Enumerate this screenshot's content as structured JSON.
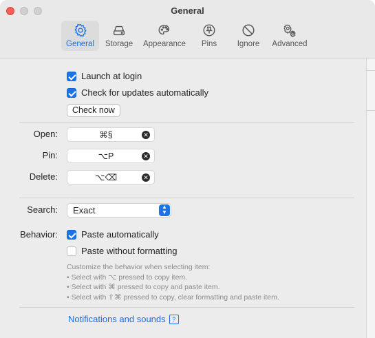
{
  "window": {
    "title": "General"
  },
  "toolbar": {
    "items": [
      {
        "label": "General",
        "icon": "gear-icon",
        "active": true
      },
      {
        "label": "Storage",
        "icon": "disk-icon"
      },
      {
        "label": "Appearance",
        "icon": "palette-icon"
      },
      {
        "label": "Pins",
        "icon": "pin-icon"
      },
      {
        "label": "Ignore",
        "icon": "prohibit-icon"
      },
      {
        "label": "Advanced",
        "icon": "gears-icon"
      }
    ]
  },
  "startup": {
    "launch_at_login": {
      "label": "Launch at login",
      "checked": true
    },
    "check_updates": {
      "label": "Check for updates automatically",
      "checked": true
    },
    "check_now_label": "Check now"
  },
  "shortcuts": {
    "open": {
      "label": "Open:",
      "value": "⌘§"
    },
    "pin": {
      "label": "Pin:",
      "value": "⌥P"
    },
    "delete": {
      "label": "Delete:",
      "value": "⌥⌫"
    }
  },
  "search": {
    "label": "Search:",
    "value": "Exact"
  },
  "behavior": {
    "label": "Behavior:",
    "paste_automatically": {
      "label": "Paste automatically",
      "checked": true
    },
    "paste_without_formatting": {
      "label": "Paste without formatting",
      "checked": false
    },
    "hint": {
      "title": "Customize the behavior when selecting item:",
      "line1": "• Select with ⌥ pressed to copy item.",
      "line2": "• Select with ⌘ pressed to copy and paste item.",
      "line3": "• Select with ⇧⌘ pressed to copy, clear formatting and paste item."
    }
  },
  "footer": {
    "link_label": "Notifications and sounds",
    "help_badge": "?"
  },
  "colors": {
    "accent": "#1a73e8",
    "close": "#ff5f57"
  }
}
